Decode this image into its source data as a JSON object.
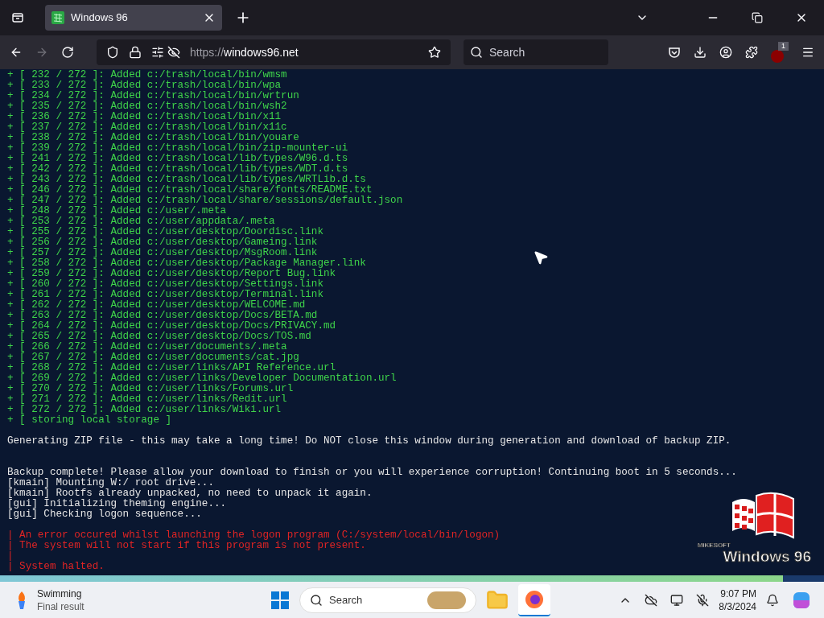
{
  "browser": {
    "tab_title": "Windows 96",
    "url_scheme": "https://",
    "url_host": "windows96.net",
    "search_placeholder": "Search",
    "extension_badge": "1"
  },
  "terminal": {
    "lines": [
      {
        "kind": "added",
        "text": "+ [ 232 / 272 ]: Added c:/trash/local/bin/wmsm"
      },
      {
        "kind": "added",
        "text": "+ [ 233 / 272 ]: Added c:/trash/local/bin/wpa"
      },
      {
        "kind": "added",
        "text": "+ [ 234 / 272 ]: Added c:/trash/local/bin/wrtrun"
      },
      {
        "kind": "added",
        "text": "+ [ 235 / 272 ]: Added c:/trash/local/bin/wsh2"
      },
      {
        "kind": "added",
        "text": "+ [ 236 / 272 ]: Added c:/trash/local/bin/x11"
      },
      {
        "kind": "added",
        "text": "+ [ 237 / 272 ]: Added c:/trash/local/bin/x11c"
      },
      {
        "kind": "added",
        "text": "+ [ 238 / 272 ]: Added c:/trash/local/bin/youare"
      },
      {
        "kind": "added",
        "text": "+ [ 239 / 272 ]: Added c:/trash/local/bin/zip-mounter-ui"
      },
      {
        "kind": "added",
        "text": "+ [ 241 / 272 ]: Added c:/trash/local/lib/types/W96.d.ts"
      },
      {
        "kind": "added",
        "text": "+ [ 242 / 272 ]: Added c:/trash/local/lib/types/WDT.d.ts"
      },
      {
        "kind": "added",
        "text": "+ [ 243 / 272 ]: Added c:/trash/local/lib/types/WRTLib.d.ts"
      },
      {
        "kind": "added",
        "text": "+ [ 246 / 272 ]: Added c:/trash/local/share/fonts/README.txt"
      },
      {
        "kind": "added",
        "text": "+ [ 247 / 272 ]: Added c:/trash/local/share/sessions/default.json"
      },
      {
        "kind": "added",
        "text": "+ [ 248 / 272 ]: Added c:/user/.meta"
      },
      {
        "kind": "added",
        "text": "+ [ 253 / 272 ]: Added c:/user/appdata/.meta"
      },
      {
        "kind": "added",
        "text": "+ [ 255 / 272 ]: Added c:/user/desktop/Doordisc.link"
      },
      {
        "kind": "added",
        "text": "+ [ 256 / 272 ]: Added c:/user/desktop/Gameing.link"
      },
      {
        "kind": "added",
        "text": "+ [ 257 / 272 ]: Added c:/user/desktop/MsgRoom.link"
      },
      {
        "kind": "added",
        "text": "+ [ 258 / 272 ]: Added c:/user/desktop/Package Manager.link"
      },
      {
        "kind": "added",
        "text": "+ [ 259 / 272 ]: Added c:/user/desktop/Report Bug.link"
      },
      {
        "kind": "added",
        "text": "+ [ 260 / 272 ]: Added c:/user/desktop/Settings.link"
      },
      {
        "kind": "added",
        "text": "+ [ 261 / 272 ]: Added c:/user/desktop/Terminal.link"
      },
      {
        "kind": "added",
        "text": "+ [ 262 / 272 ]: Added c:/user/desktop/WELCOME.md"
      },
      {
        "kind": "added",
        "text": "+ [ 263 / 272 ]: Added c:/user/desktop/Docs/BETA.md"
      },
      {
        "kind": "added",
        "text": "+ [ 264 / 272 ]: Added c:/user/desktop/Docs/PRIVACY.md"
      },
      {
        "kind": "added",
        "text": "+ [ 265 / 272 ]: Added c:/user/desktop/Docs/TOS.md"
      },
      {
        "kind": "added",
        "text": "+ [ 266 / 272 ]: Added c:/user/documents/.meta"
      },
      {
        "kind": "added",
        "text": "+ [ 267 / 272 ]: Added c:/user/documents/cat.jpg"
      },
      {
        "kind": "added",
        "text": "+ [ 268 / 272 ]: Added c:/user/links/API Reference.url"
      },
      {
        "kind": "added",
        "text": "+ [ 269 / 272 ]: Added c:/user/links/Developer Documentation.url"
      },
      {
        "kind": "added",
        "text": "+ [ 270 / 272 ]: Added c:/user/links/Forums.url"
      },
      {
        "kind": "added",
        "text": "+ [ 271 / 272 ]: Added c:/user/links/Redit.url"
      },
      {
        "kind": "added",
        "text": "+ [ 272 / 272 ]: Added c:/user/links/Wiki.url"
      },
      {
        "kind": "added",
        "text": "+ [ storing local storage ]"
      },
      {
        "kind": "blank"
      },
      {
        "kind": "info",
        "text": "Generating ZIP file - this may take a long time! Do NOT close this window during generation and download of backup ZIP."
      },
      {
        "kind": "blank"
      },
      {
        "kind": "blank"
      },
      {
        "kind": "info",
        "text": "Backup complete! Please allow your download to finish or you will experience corruption! Continuing boot in 5 seconds..."
      },
      {
        "kind": "info",
        "text": "[kmain] Mounting W:/ root drive..."
      },
      {
        "kind": "info",
        "text": "[kmain] Rootfs already unpacked, no need to unpack it again."
      },
      {
        "kind": "info",
        "text": "[gui] Initializing theming engine..."
      },
      {
        "kind": "info",
        "text": "[gui] Checking logon sequence..."
      },
      {
        "kind": "blank"
      },
      {
        "kind": "error",
        "text": "| An error occured whilst launching the logon program (C:/system/local/bin/logon)"
      },
      {
        "kind": "error",
        "text": "| The system will not start if this program is not present."
      },
      {
        "kind": "error",
        "text": "|"
      },
      {
        "kind": "error",
        "text": "| System halted."
      }
    ]
  },
  "logo": {
    "brand": "MIKESOFT",
    "product": "Windows 96"
  },
  "progress": {
    "level": 0.95
  },
  "taskbar": {
    "widget_title": "Swimming",
    "widget_subtitle": "Final result",
    "search_placeholder": "Search",
    "time": "9:07 PM",
    "date": "8/3/2024"
  }
}
